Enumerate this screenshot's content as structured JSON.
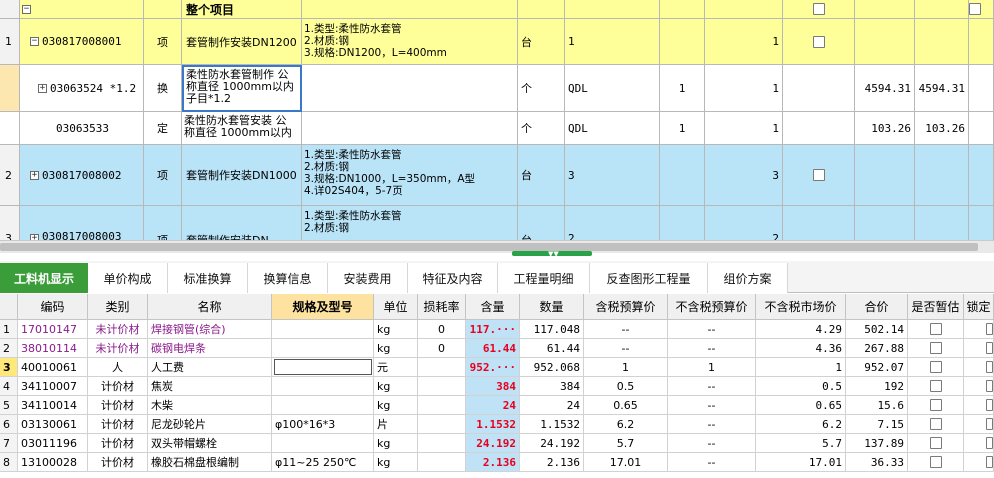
{
  "top_grid": {
    "header_row": {
      "label": "整个项目"
    },
    "rows": [
      {
        "num": "1",
        "code": "030817008001",
        "type": "项",
        "name": "套管制作安装DN1200",
        "spec": "1.类型:柔性防水套管\n2.材质:钢\n3.规格:DN1200，L=400mm",
        "unit": "台",
        "expr": "1",
        "qty": "1"
      },
      {
        "num": "",
        "code": "03063524 *1.2",
        "type": "换",
        "name": "柔性防水套管制作 公\n称直径 1000mm以内\n子目*1.2",
        "spec": "",
        "unit": "个",
        "expr": "QDL",
        "coef": "1",
        "qty": "1",
        "price": "4594.31",
        "total": "4594.31"
      },
      {
        "num": "",
        "code": "03063533",
        "type": "定",
        "name": "柔性防水套管安装 公\n称直径 1000mm以内",
        "spec": "",
        "unit": "个",
        "expr": "QDL",
        "coef": "1",
        "qty": "1",
        "price": "103.26",
        "total": "103.26"
      },
      {
        "num": "2",
        "code": "030817008002",
        "type": "项",
        "name": "套管制作安装DN1000",
        "spec": "1.类型:柔性防水套管\n2.材质:钢\n3.规格:DN1000，L=350mm，A型\n4.详02S404，5-7页",
        "unit": "台",
        "expr": "3",
        "qty": "3"
      },
      {
        "num": "3",
        "code": "030817008003",
        "type": "项",
        "name": "套管制作安装DN",
        "spec": "1.类型:柔性防水套管\n2.材质:钢",
        "unit": "台",
        "expr": "2",
        "qty": "2"
      }
    ]
  },
  "tabs": [
    "工料机显示",
    "单价构成",
    "标准换算",
    "换算信息",
    "安装费用",
    "特征及内容",
    "工程量明细",
    "反查图形工程量",
    "组价方案"
  ],
  "bottom_grid": {
    "headers": [
      "编码",
      "类别",
      "名称",
      "规格及型号",
      "单位",
      "损耗率",
      "含量",
      "数量",
      "含税预算价",
      "不含税预算价",
      "不含税市场价",
      "合价",
      "是否暂估",
      "锁定"
    ],
    "rows": [
      {
        "num": "1",
        "code": "17010147",
        "cat": "未计价材",
        "name": "焊接钢管(综合)",
        "spec": "",
        "unit": "kg",
        "loss": "0",
        "content": "117.···",
        "qty": "117.048",
        "tax_price": "--",
        "notax_price": "--",
        "market": "4.29",
        "total": "502.14",
        "purple": true
      },
      {
        "num": "2",
        "code": "38010114",
        "cat": "未计价材",
        "name": "碳钢电焊条",
        "spec": "",
        "unit": "kg",
        "loss": "0",
        "content": "61.44",
        "qty": "61.44",
        "tax_price": "--",
        "notax_price": "--",
        "market": "4.36",
        "total": "267.88",
        "purple": true
      },
      {
        "num": "3",
        "code": "40010061",
        "cat": "人",
        "name": "人工费",
        "spec": "",
        "unit": "元",
        "loss": "",
        "content": "952.···",
        "qty": "952.068",
        "tax_price": "1",
        "notax_price": "1",
        "market": "1",
        "total": "952.07",
        "purple": false
      },
      {
        "num": "4",
        "code": "34110007",
        "cat": "计价材",
        "name": "焦炭",
        "spec": "",
        "unit": "kg",
        "loss": "",
        "content": "384",
        "qty": "384",
        "tax_price": "0.5",
        "notax_price": "--",
        "market": "0.5",
        "total": "192",
        "purple": false
      },
      {
        "num": "5",
        "code": "34110014",
        "cat": "计价材",
        "name": "木柴",
        "spec": "",
        "unit": "kg",
        "loss": "",
        "content": "24",
        "qty": "24",
        "tax_price": "0.65",
        "notax_price": "--",
        "market": "0.65",
        "total": "15.6",
        "purple": false
      },
      {
        "num": "6",
        "code": "03130061",
        "cat": "计价材",
        "name": "尼龙砂轮片",
        "spec": "φ100*16*3",
        "unit": "片",
        "loss": "",
        "content": "1.1532",
        "qty": "1.1532",
        "tax_price": "6.2",
        "notax_price": "--",
        "market": "6.2",
        "total": "7.15",
        "purple": false
      },
      {
        "num": "7",
        "code": "03011196",
        "cat": "计价材",
        "name": "双头带帽螺栓",
        "spec": "",
        "unit": "kg",
        "loss": "",
        "content": "24.192",
        "qty": "24.192",
        "tax_price": "5.7",
        "notax_price": "--",
        "market": "5.7",
        "total": "137.89",
        "purple": false
      },
      {
        "num": "8",
        "code": "13100028",
        "cat": "计价材",
        "name": "橡胶石棉盘根编制",
        "spec": "φ11~25 250℃",
        "unit": "kg",
        "loss": "",
        "content": "2.136",
        "qty": "2.136",
        "tax_price": "17.01",
        "notax_price": "--",
        "market": "17.01",
        "total": "36.33",
        "purple": false
      }
    ]
  }
}
